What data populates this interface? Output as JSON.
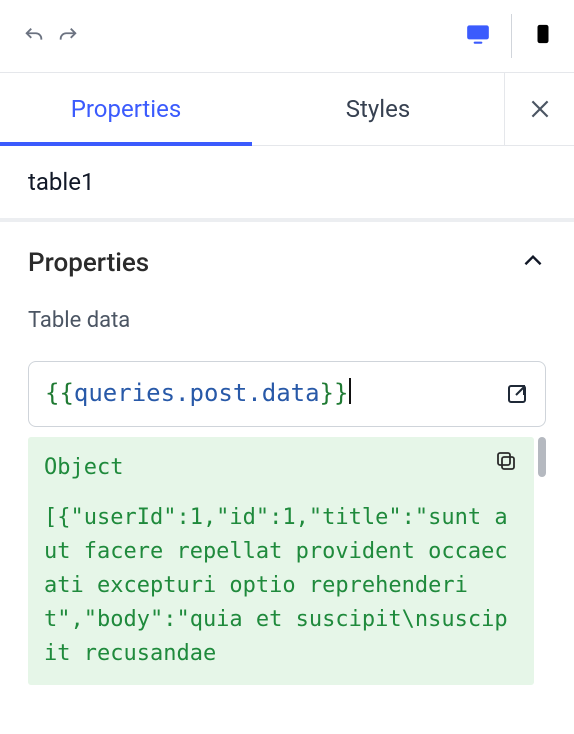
{
  "tabs": {
    "properties": "Properties",
    "styles": "Styles"
  },
  "componentName": "table1",
  "section": {
    "title": "Properties",
    "expanded": true
  },
  "field": {
    "label": "Table data",
    "expression": "queries.post.data",
    "braceOpen": "{{",
    "braceClose": "}}"
  },
  "preview": {
    "type": "Object",
    "body": "[{\"userId\":1,\"id\":1,\"title\":\"sunt aut facere repellat provident occaecati excepturi optio reprehenderit\",\"body\":\"quia et suscipit\\nsuscipit recusandae"
  }
}
